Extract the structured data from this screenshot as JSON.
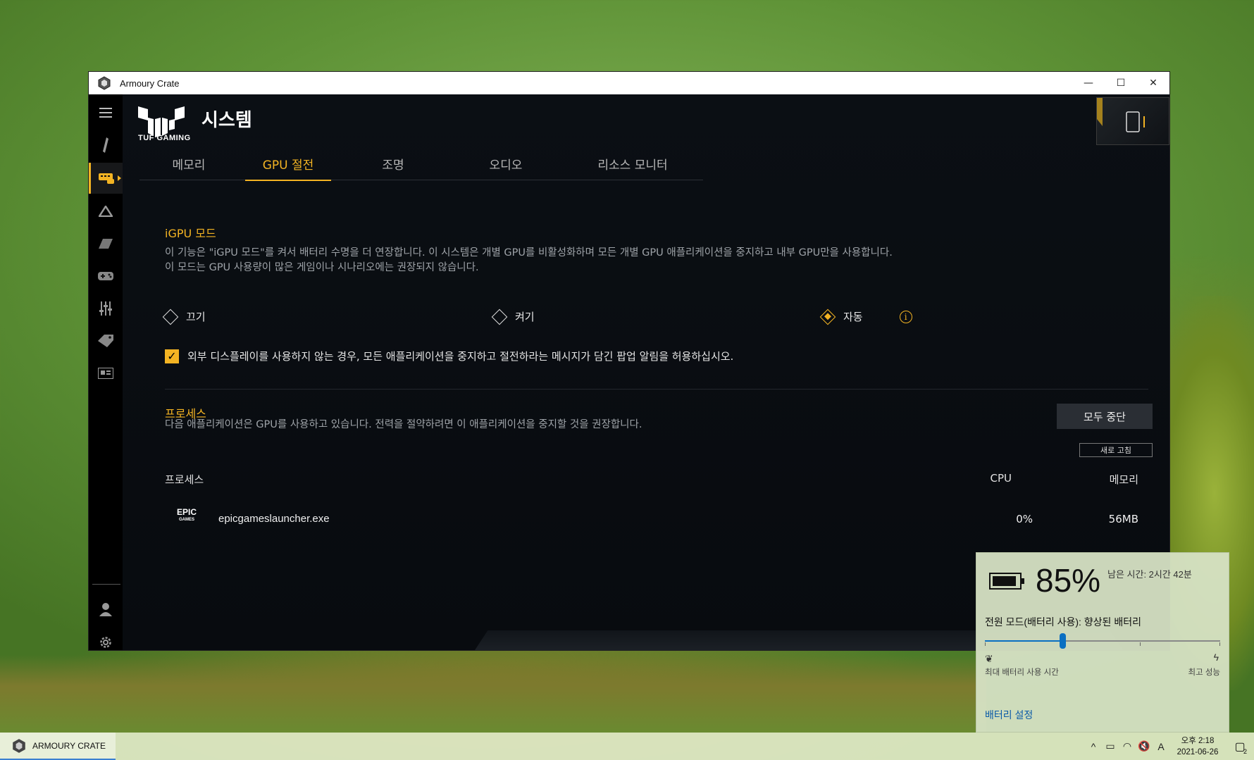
{
  "window": {
    "title": "Armoury Crate",
    "brand_text": "TUF GAMING",
    "page_title": "시스템",
    "controls": {
      "minimize": "—",
      "maximize": "☐",
      "close": "✕"
    }
  },
  "tabs": [
    {
      "label": "메모리"
    },
    {
      "label": "GPU 절전",
      "active": true
    },
    {
      "label": "조명"
    },
    {
      "label": "오디오"
    },
    {
      "label": "리소스 모니터"
    }
  ],
  "igpu": {
    "title": "iGPU 모드",
    "desc_line1": "이 기능은 \"iGPU 모드\"를 켜서 배터리 수명을 더 연장합니다. 이 시스템은 개별 GPU를 비활성화하며 모든 개별 GPU 애플리케이션을 중지하고 내부 GPU만을 사용합니다.",
    "desc_line2": "이 모드는 GPU 사용량이 많은 게임이나 시나리오에는 권장되지 않습니다.",
    "options": [
      {
        "label": "끄기",
        "selected": false
      },
      {
        "label": "켜기",
        "selected": false
      },
      {
        "label": "자동",
        "selected": true
      }
    ],
    "info_glyph": "i",
    "checkbox_label": "외부 디스플레이를 사용하지 않는 경우, 모든 애플리케이션을 중지하고 절전하라는 메시지가 담긴 팝업 알림을 허용하십시오.",
    "checkbox_checked": true
  },
  "process": {
    "title": "프로세스",
    "desc": "다음 애플리케이션은 GPU를 사용하고 있습니다. 전력을 절약하려면 이 애플리케이션을 중지할 것을 권장합니다.",
    "stop_all_label": "모두 중단",
    "refresh_label": "새로 고침",
    "headers": {
      "name": "프로세스",
      "cpu": "CPU",
      "memory": "메모리"
    },
    "rows": [
      {
        "logo_top": "EPIC",
        "logo_bottom": "GAMES",
        "name": "epicgameslauncher.exe",
        "cpu": "0%",
        "memory": "56MB"
      }
    ]
  },
  "battery_flyout": {
    "percent": "85%",
    "percent_value": 85,
    "remaining": "남은 시간: 2시간 42분",
    "power_mode": "전원 모드(배터리 사용): 향상된 배터리",
    "slider_value": 33,
    "left_label": "최대 배터리 사용 시간",
    "right_label": "최고 성능",
    "settings_link": "배터리 설정"
  },
  "taskbar": {
    "app_label": "ARMOURY CRATE",
    "tray": {
      "chevron": "^",
      "ime": "A"
    },
    "clock_time": "오후 2:18",
    "clock_date": "2021-06-26",
    "notification_count": "2"
  },
  "colors": {
    "accent": "#f3b323",
    "window_bg": "#050709",
    "slider": "#0a6fc2"
  }
}
